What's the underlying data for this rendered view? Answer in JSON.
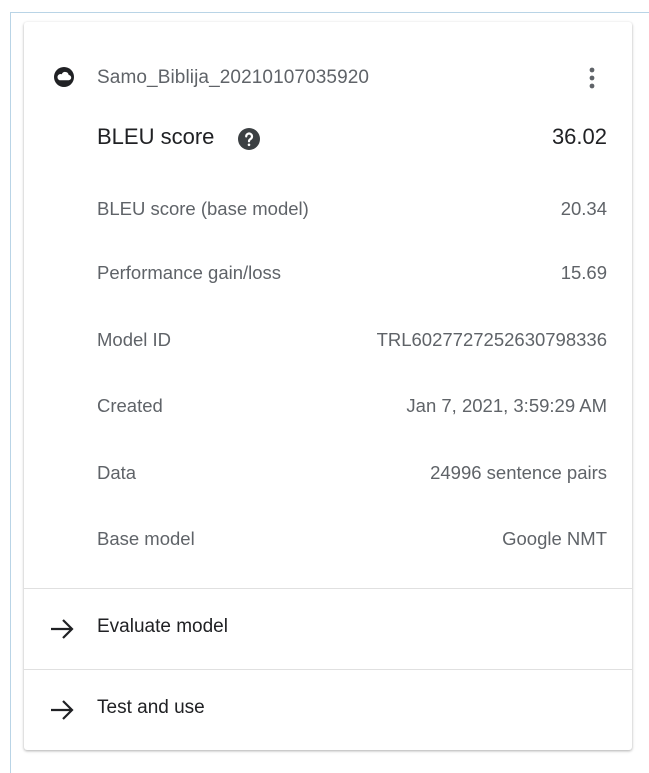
{
  "model": {
    "name": "Samo_Biblija_20210107035920",
    "status_icon": "cloud-circle-icon",
    "menu_icon": "more-vert-icon"
  },
  "score": {
    "label": "BLEU score",
    "help_icon": "help-circle-icon",
    "value": "36.02"
  },
  "details": [
    {
      "label": "BLEU score (base model)",
      "value": "20.34"
    },
    {
      "label": "Performance gain/loss",
      "value": "15.69"
    },
    {
      "label": "Model ID",
      "value": "TRL6027727252630798336"
    },
    {
      "label": "Created",
      "value": "Jan 7, 2021, 3:59:29 AM"
    },
    {
      "label": "Data",
      "value": "24996 sentence pairs"
    },
    {
      "label": "Base model",
      "value": "Google NMT"
    }
  ],
  "actions": [
    {
      "label": "Evaluate model",
      "icon": "arrow-right-icon"
    },
    {
      "label": "Test and use",
      "icon": "arrow-right-icon"
    }
  ],
  "colors": {
    "primary_text": "#202124",
    "secondary_text": "#5f6368",
    "divider": "#e0e0e0"
  }
}
